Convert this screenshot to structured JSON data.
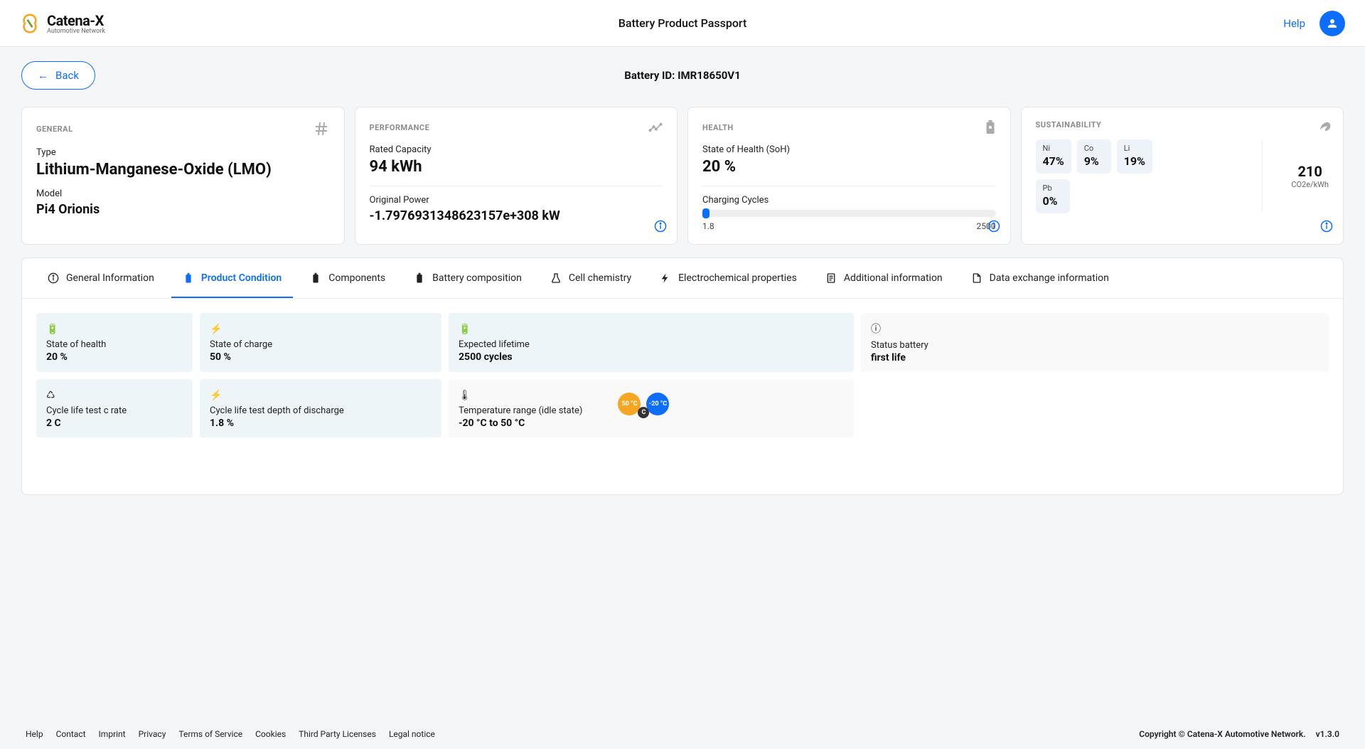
{
  "header": {
    "logo_text": "Catena-X",
    "logo_sub": "Automotive Network",
    "title": "Battery Product Passport",
    "help": "Help"
  },
  "back_label": "Back",
  "battery_id_label": "Battery ID: ",
  "battery_id": "IMR18650V1",
  "cards": {
    "general": {
      "title": "GENERAL",
      "type_label": "Type",
      "type_value": "Lithium-Manganese-Oxide (LMO)",
      "model_label": "Model",
      "model_value": "Pi4 Orionis"
    },
    "performance": {
      "title": "PERFORMANCE",
      "capacity_label": "Rated Capacity",
      "capacity_value": "94 kWh",
      "power_label": "Original Power",
      "power_value": "-1.7976931348623157e+308 kW"
    },
    "health": {
      "title": "HEALTH",
      "soh_label": "State of Health (SoH)",
      "soh_value": "20 %",
      "cycles_label": "Charging Cycles",
      "cycles_min": "1.8",
      "cycles_max": "2500"
    },
    "sustainability": {
      "title": "SUSTAINABILITY",
      "chips": [
        {
          "label": "Ni",
          "value": "47%"
        },
        {
          "label": "Co",
          "value": "9%"
        },
        {
          "label": "Li",
          "value": "19%"
        },
        {
          "label": "Pb",
          "value": "0%"
        }
      ],
      "co2_value": "210",
      "co2_unit": "CO2e/kWh"
    }
  },
  "tabs": [
    "General Information",
    "Product Condition",
    "Components",
    "Battery composition",
    "Cell chemistry",
    "Electrochemical properties",
    "Additional information",
    "Data exchange information"
  ],
  "tiles": {
    "soh": {
      "label": "State of health",
      "value": "20 %"
    },
    "soc": {
      "label": "State of charge",
      "value": "50 %"
    },
    "lifetime": {
      "label": "Expected lifetime",
      "value": "2500 cycles"
    },
    "status": {
      "label": "Status battery",
      "value": "first life"
    },
    "crate": {
      "label": "Cycle life test c rate",
      "value": "2 C"
    },
    "dod": {
      "label": "Cycle life test depth of discharge",
      "value": "1.8 %"
    },
    "temp": {
      "label": "Temperature range (idle state)",
      "value": "-20 °C to 50 °C",
      "max": "50 °C",
      "min": "-20 °C"
    }
  },
  "footer": {
    "links": [
      "Help",
      "Contact",
      "Imprint",
      "Privacy",
      "Terms of Service",
      "Cookies",
      "Third Party Licenses",
      "Legal notice"
    ],
    "copyright": "Copyright © Catena-X Automotive Network.",
    "version": "v1.3.0"
  }
}
